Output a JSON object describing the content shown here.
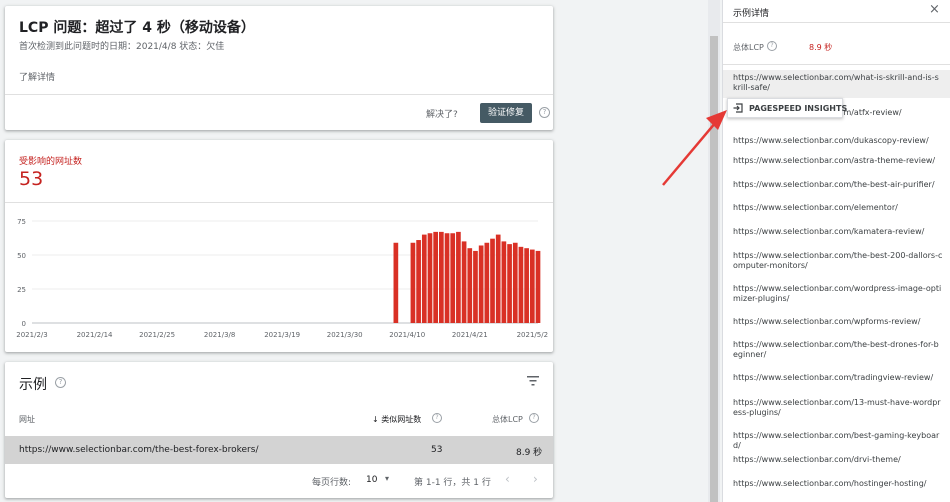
{
  "issue": {
    "title": "LCP 问题：超过了 4 秒（移动设备）",
    "subtitle": "首次检测到此问题时的日期：2021/4/8   状态：欠佳",
    "learn_more": "了解详情",
    "resolved_q": "解决了?",
    "validate_button": "验证修复",
    "help_icon": "?"
  },
  "chart": {
    "affected_label": "受影响的网址数",
    "affected_count": "53",
    "bar_color": "#d93025"
  },
  "chart_data": {
    "type": "bar",
    "ylim": [
      0,
      75
    ],
    "yticks": [
      "0",
      "25",
      "50",
      "75"
    ],
    "xtick_labels": [
      "2021/2/3",
      "2021/2/14",
      "2021/2/25",
      "2021/3/8",
      "2021/3/19",
      "2021/3/30",
      "2021/4/10",
      "2021/4/21",
      "2021/5/2"
    ],
    "xrange": [
      "2021/2/3",
      "2021/5/3"
    ],
    "dates": [
      "2021/4/8",
      "2021/4/11",
      "2021/4/12",
      "2021/4/13",
      "2021/4/14",
      "2021/4/15",
      "2021/4/16",
      "2021/4/17",
      "2021/4/18",
      "2021/4/19",
      "2021/4/20",
      "2021/4/21",
      "2021/4/22",
      "2021/4/23",
      "2021/4/24",
      "2021/4/25",
      "2021/4/26",
      "2021/4/27",
      "2021/4/28",
      "2021/4/29",
      "2021/4/30",
      "2021/5/1",
      "2021/5/2",
      "2021/5/3"
    ],
    "values": [
      59,
      59,
      61,
      65,
      66,
      67,
      67,
      66,
      66,
      67,
      60,
      55,
      53,
      57,
      59,
      62,
      65,
      60,
      58,
      59,
      56,
      55,
      54,
      53
    ],
    "grid": true
  },
  "examples": {
    "title": "示例",
    "columns": {
      "url": "网址",
      "similar": "类似网址数",
      "lcp": "总体LCP"
    },
    "rows": [
      {
        "url": "https://www.selectionbar.com/the-best-forex-brokers/",
        "similar": "53",
        "lcp": "8.9 秒"
      }
    ],
    "pager": {
      "rows_per_page_label": "每页行数:",
      "rows_per_page": "10",
      "range": "第 1-1 行，共 1 行",
      "prev": "‹",
      "next": "›",
      "caret": "▾"
    }
  },
  "panel": {
    "title": "示例详情",
    "close": "×",
    "lcp_label": "总体LCP",
    "lcp_value": "8.9 秒",
    "urls": [
      "https://www.selectionbar.com/what-is-skrill-and-is-skrill-safe/",
      "https://www.selectionbar.com/atfx-review/",
      "https://www.selectionbar.com/dukascopy-review/",
      "https://www.selectionbar.com/astra-theme-review/",
      "https://www.selectionbar.com/the-best-air-purifier/",
      "https://www.selectionbar.com/elementor/",
      "https://www.selectionbar.com/kamatera-review/",
      "https://www.selectionbar.com/the-best-200-dallors-computer-monitors/",
      "https://www.selectionbar.com/wordpress-image-optimizer-plugins/",
      "https://www.selectionbar.com/wpforms-review/",
      "https://www.selectionbar.com/the-best-drones-for-beginner/",
      "https://www.selectionbar.com/tradingview-review/",
      "https://www.selectionbar.com/13-must-have-wordpress-plugins/",
      "https://www.selectionbar.com/best-gaming-keyboard/",
      "https://www.selectionbar.com/drvi-theme/",
      "https://www.selectionbar.com/hostinger-hosting/"
    ],
    "psi_label": "PAGESPEED INSIGHTS",
    "arrow_color": "#e53935"
  }
}
